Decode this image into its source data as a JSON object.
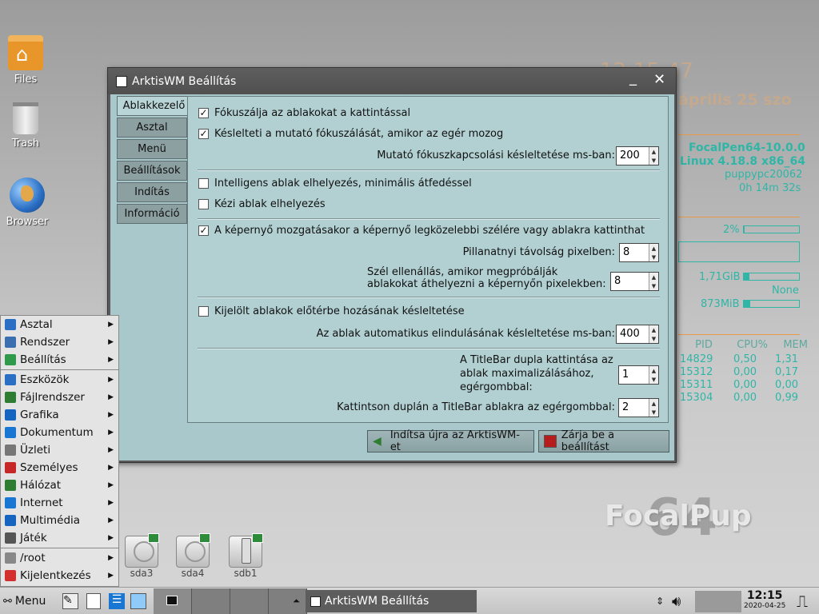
{
  "desktop": {
    "icons": [
      {
        "label": "Files",
        "icon": "home-folder-icon"
      },
      {
        "label": "Trash",
        "icon": "trash-icon"
      },
      {
        "label": "Browser",
        "icon": "globe-icon"
      }
    ]
  },
  "conky": {
    "time": "12:15:47",
    "date": "április 25 szo",
    "distro": "FocalPen64-10.0.0",
    "kernel": "Linux 4.18.8 x86_64",
    "host": "puppypc20062",
    "uptime": "0h 14m 32s",
    "cpu": "2%",
    "cpu_level": 0.02,
    "mem": "1,71GiB",
    "mem_level": 0.1,
    "swap": "None",
    "disk": "873MiB",
    "disk_level": 0.12,
    "proc_headers": [
      "PID",
      "CPU%",
      "MEM"
    ],
    "procs": [
      [
        "14829",
        "0,50",
        "1,31"
      ],
      [
        "15312",
        "0,00",
        "0,17"
      ],
      [
        "15311",
        "0,00",
        "0,00"
      ],
      [
        "15304",
        "0,00",
        "0,99"
      ]
    ],
    "brand": "FocalPup",
    "brand_num": "64",
    "color": "#2fb6a7"
  },
  "dialog": {
    "title": "ArktisWM Beállítás",
    "minimize_glyph": "_",
    "close_glyph": "✕",
    "tabs": [
      "Ablakkezelő",
      "Asztal",
      "Menü",
      "Beállítások",
      "Indítás",
      "Információ"
    ],
    "active_tab": 0,
    "options": {
      "focus_click": {
        "label": "Fókuszálja az ablakokat a kattintással",
        "checked": "✓"
      },
      "delay_focus": {
        "label": "Késlelteti a mutató fókuszálását, amikor az egér mozog",
        "checked": "✓"
      },
      "focus_delay_label": "Mutató fókuszkapcsolási késleltetése ms-ban:",
      "focus_delay_value": "200",
      "smart_place": {
        "label": "Intelligens ablak elhelyezés, minimális átfedéssel",
        "checked": ""
      },
      "manual_place": {
        "label": "Kézi ablak elhelyezés",
        "checked": ""
      },
      "snap": {
        "label": "A képernyő mozgatásakor a képernyő legközelebbi szélére vagy ablakra kattinthat",
        "checked": "✓"
      },
      "snap_dist_label": "Pillanatnyi távolság pixelben:",
      "snap_dist_value": "8",
      "edge_res_label_1": "Szél ellenállás, amikor megpróbálják",
      "edge_res_label_2": "ablakokat áthelyezni a képernyőn pixelekben:",
      "edge_res_value": "8",
      "raise_delay": {
        "label": "Kijelölt ablakok előtérbe hozásának késleltetése",
        "checked": ""
      },
      "autoraise_label": "Az ablak automatikus elindulásának késleltetése ms-ban:",
      "autoraise_value": "400",
      "dbl_max_label_1": "A TitleBar dupla kattintása az",
      "dbl_max_label_2": "ablak maximalizálásához,",
      "dbl_max_label_3": "egérgombbal:",
      "dbl_max_value": "1",
      "dbl_title_label": "Kattintson duplán a TitleBar ablakra az egérgombbal:",
      "dbl_title_value": "2"
    },
    "restart_button": "Indítsa újra az ArktisWM-et",
    "close_button": "Zárja be a beállítást"
  },
  "menu": {
    "items": [
      {
        "label": "Asztal",
        "icon": "desktop-icon",
        "color": "#2a6fc4"
      },
      {
        "label": "Rendszer",
        "icon": "system-icon",
        "color": "#3b6fb0"
      },
      {
        "label": "Beállítás",
        "icon": "settings-icon",
        "color": "#2e9a4a"
      },
      {
        "label": "Eszközök",
        "icon": "tools-icon",
        "color": "#2a6fc4"
      },
      {
        "label": "Fájlrendszer",
        "icon": "filesystem-icon",
        "color": "#2e7d32"
      },
      {
        "label": "Grafika",
        "icon": "graphics-icon",
        "color": "#1565c0"
      },
      {
        "label": "Dokumentum",
        "icon": "document-icon",
        "color": "#1976d2"
      },
      {
        "label": "Üzleti",
        "icon": "business-icon",
        "color": "#777777"
      },
      {
        "label": "Személyes",
        "icon": "calendar-icon",
        "color": "#c62828"
      },
      {
        "label": "Hálózat",
        "icon": "network-icon",
        "color": "#2e7d32"
      },
      {
        "label": "Internet",
        "icon": "internet-icon",
        "color": "#1976d2"
      },
      {
        "label": "Multimédia",
        "icon": "multimedia-icon",
        "color": "#1565c0"
      },
      {
        "label": "Játék",
        "icon": "game-icon",
        "color": "#555555"
      },
      {
        "label": "/root",
        "icon": "user-icon",
        "color": "#888888"
      },
      {
        "label": "Kijelentkezés",
        "icon": "logout-icon",
        "color": "#d32f2f"
      }
    ]
  },
  "drives": [
    {
      "label": "sda3"
    },
    {
      "label": "sda4"
    },
    {
      "label": "sdb1"
    }
  ],
  "taskbar": {
    "menu_label": "Menu",
    "task_title": "ArktisWM Beállítás",
    "clock_time": "12:15",
    "clock_date": "2020-04-25"
  }
}
